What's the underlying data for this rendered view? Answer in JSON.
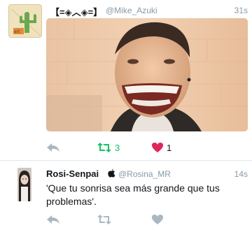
{
  "tweets": [
    {
      "display_name": "【=◈︿◈=】",
      "username": "@Mike_Azuki",
      "time": "31s",
      "avatar_icon": "cactus-sketch-avatar",
      "media_icon": "smiling-man-photo",
      "retweet_count": "3",
      "like_count": "1",
      "retweeted": true,
      "liked": true
    },
    {
      "display_name": "Rosi-Senpai",
      "verified_icon": "apple-icon",
      "username": "@Rosina_MR",
      "time": "14s",
      "text": "'Que tu sonrisa sea más grande que tus problemas'.",
      "avatar_icon": "girl-avatar"
    }
  ],
  "colors": {
    "retweet_active": "#17bf63",
    "like_active": "#e0245e",
    "icon_inactive": "#aab8c2",
    "secondary_text": "#8899a6"
  }
}
